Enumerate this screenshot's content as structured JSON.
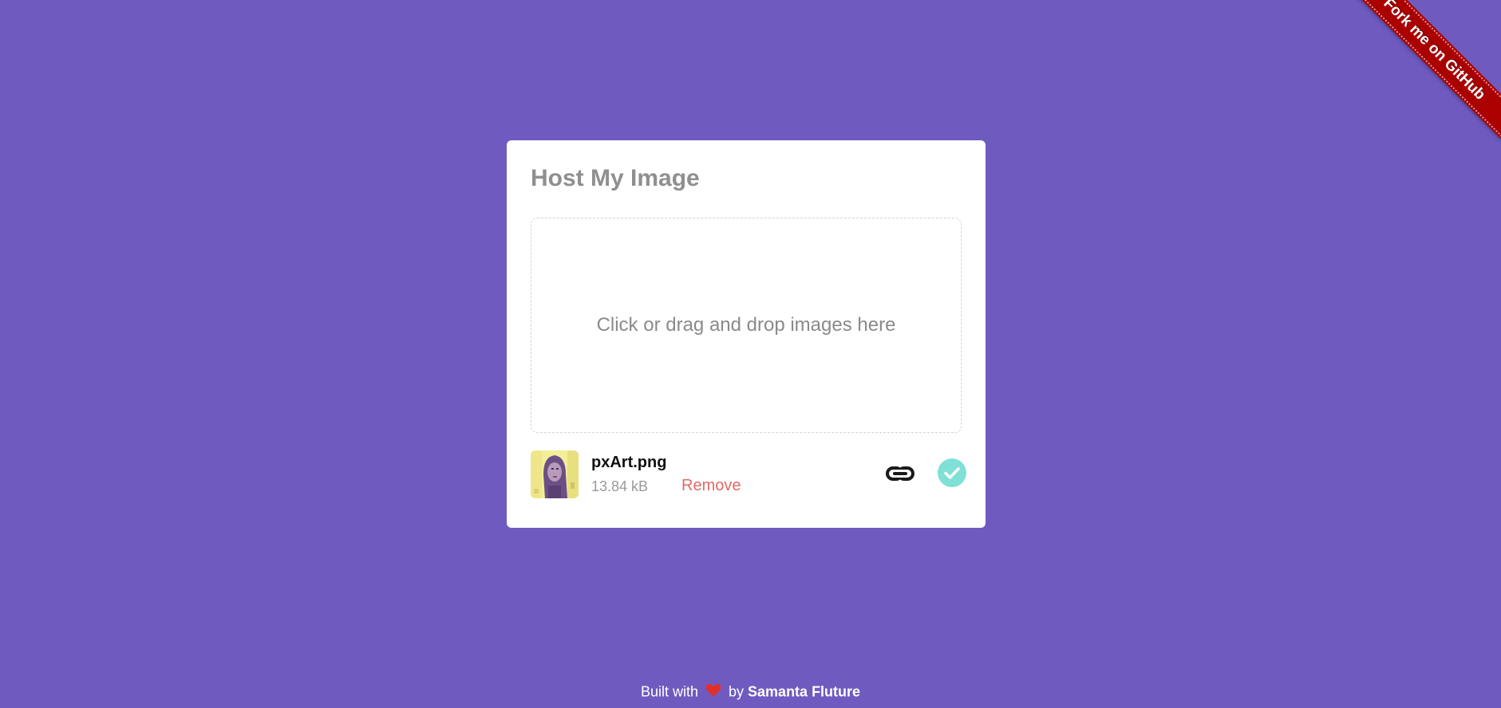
{
  "ribbon": {
    "label": "Fork me on GitHub",
    "color": "#aa0000"
  },
  "card": {
    "title": "Host My Image",
    "dropzone_text": "Click or drag and drop images here",
    "file": {
      "name": "pxArt.png",
      "size": "13.84 kB",
      "remove_label": "Remove",
      "thumbnail_icon": "image-thumbnail",
      "link_icon": "link-icon",
      "status_icon": "check-circle-icon",
      "status_color": "#7fe0d6"
    }
  },
  "footer": {
    "prefix": "Built with",
    "heart_icon": "heart-icon",
    "by": "by",
    "author": "Samanta Fluture",
    "heart_color": "#e0302c"
  },
  "colors": {
    "background": "#6f5bc0",
    "card": "#ffffff",
    "remove": "#e06a66"
  }
}
